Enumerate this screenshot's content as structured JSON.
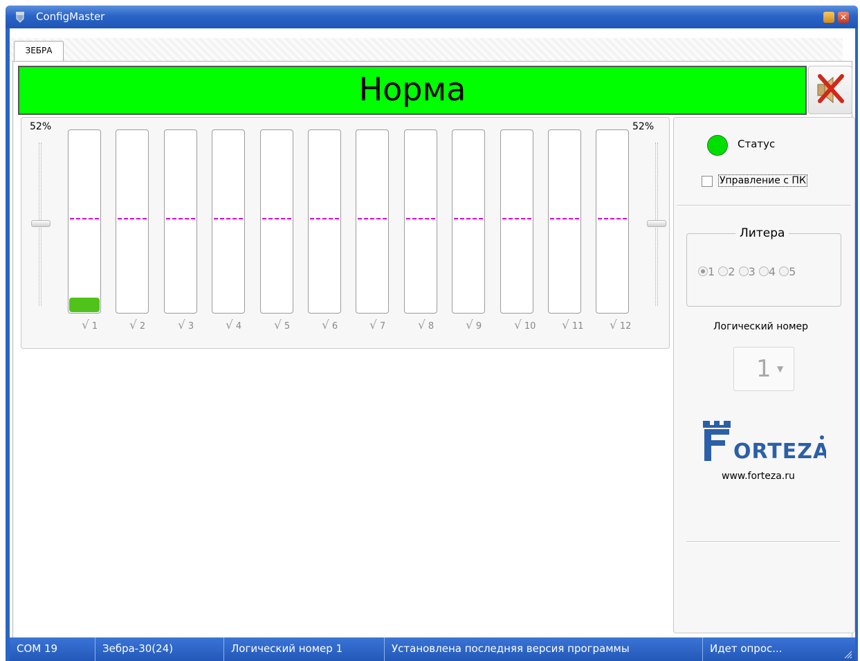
{
  "window": {
    "title": "ConfigMaster",
    "colors": {
      "titlebar": "#2a64c7",
      "status_ok": "#00ff00",
      "level_fill": "#4fc31a",
      "threshold": "#e000e0"
    }
  },
  "tabs": [
    {
      "label": "ЗЕБРА",
      "active": true
    }
  ],
  "banner": {
    "text": "Норма",
    "mute_icon": "speaker-muted-icon"
  },
  "levels": {
    "left_percent_label": "52%",
    "right_percent_label": "52%",
    "channels": [
      {
        "label": "1",
        "checked": true,
        "level": 0.08
      },
      {
        "label": "2",
        "checked": true,
        "level": 0
      },
      {
        "label": "3",
        "checked": true,
        "level": 0
      },
      {
        "label": "4",
        "checked": true,
        "level": 0
      },
      {
        "label": "5",
        "checked": true,
        "level": 0
      },
      {
        "label": "6",
        "checked": true,
        "level": 0
      },
      {
        "label": "7",
        "checked": true,
        "level": 0
      },
      {
        "label": "8",
        "checked": true,
        "level": 0
      },
      {
        "label": "9",
        "checked": true,
        "level": 0
      },
      {
        "label": "10",
        "checked": true,
        "level": 0
      },
      {
        "label": "11",
        "checked": true,
        "level": 0
      },
      {
        "label": "12",
        "checked": true,
        "level": 0
      }
    ],
    "threshold_level": 0.52
  },
  "side": {
    "status_label": "Статус",
    "pc_control_label": "Управление с ПК",
    "pc_control_checked": false,
    "litera_title": "Литера",
    "litera_options": [
      "1",
      "2",
      "3",
      "4",
      "5"
    ],
    "litera_selected": "1",
    "logical_number_label": "Логический номер",
    "logical_number_value": "1",
    "logo_text": "FORTEZA",
    "logo_url": "www.forteza.ru"
  },
  "statusbar": {
    "port": "COM 19",
    "device": "Зебра-30(24)",
    "logical": "Логический номер 1",
    "version": "Установлена последняя версия программы",
    "polling": "Идет опрос..."
  }
}
